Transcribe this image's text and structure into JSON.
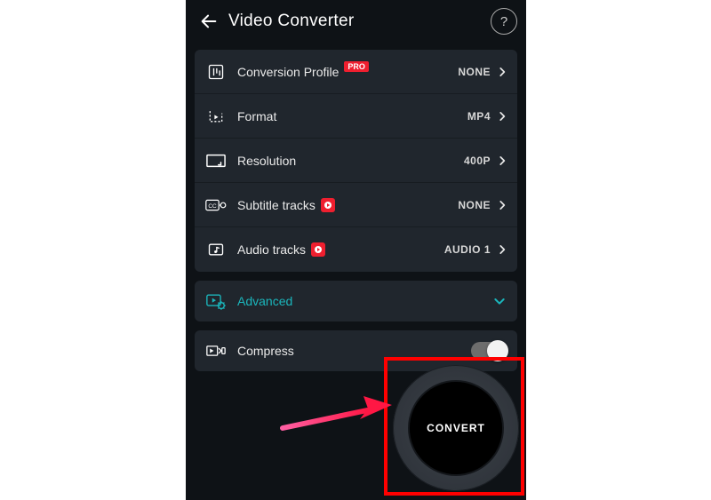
{
  "header": {
    "title": "Video Converter"
  },
  "settings": {
    "profile": {
      "label": "Conversion Profile",
      "badge": "PRO",
      "value": "NONE"
    },
    "format": {
      "label": "Format",
      "value": "MP4"
    },
    "resolution": {
      "label": "Resolution",
      "value": "400P"
    },
    "subtitles": {
      "label": "Subtitle tracks",
      "value": "NONE"
    },
    "audio": {
      "label": "Audio tracks",
      "value": "AUDIO 1"
    }
  },
  "advanced": {
    "label": "Advanced"
  },
  "compress": {
    "label": "Compress",
    "on": false
  },
  "convert": {
    "label": "CONVERT"
  },
  "help_glyph": "?"
}
